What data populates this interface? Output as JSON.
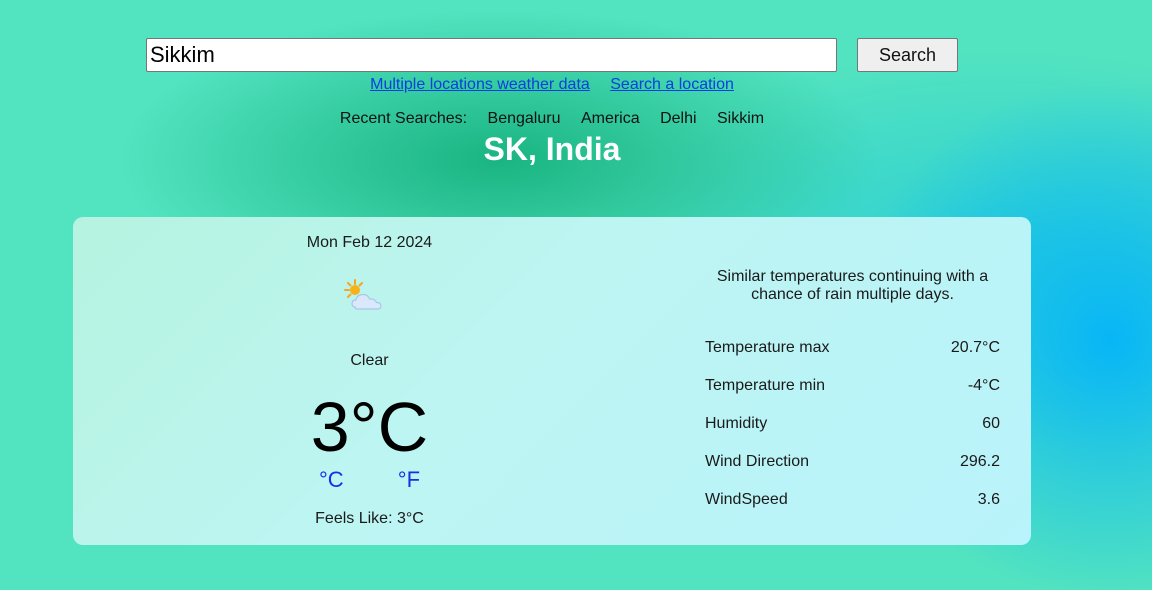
{
  "search": {
    "value": "Sikkim",
    "button_label": "Search"
  },
  "links": {
    "multiple": "Multiple locations weather data",
    "search_location": "Search a location"
  },
  "recent": {
    "label": "Recent Searches:",
    "items": [
      "Bengaluru",
      "America",
      "Delhi",
      "Sikkim"
    ]
  },
  "location": "SK, India",
  "current": {
    "date": "Mon Feb 12 2024",
    "icon": "sun-behind-cloud-icon",
    "condition": "Clear",
    "temperature": "3°C",
    "unit_c": "°C",
    "unit_f": "°F",
    "feels_like": "Feels Like: 3°C"
  },
  "description": "Similar temperatures continuing with a chance of rain multiple days.",
  "details": [
    {
      "label": "Temperature max",
      "value": "20.7°C"
    },
    {
      "label": "Temperature min",
      "value": "-4°C"
    },
    {
      "label": "Humidity",
      "value": "60"
    },
    {
      "label": "Wind Direction",
      "value": "296.2"
    },
    {
      "label": "WindSpeed",
      "value": "3.6"
    }
  ],
  "colors": {
    "background": "#52e3c0",
    "link": "#0a3ee0",
    "unit_link": "#1730e6",
    "title": "#ffffff"
  }
}
